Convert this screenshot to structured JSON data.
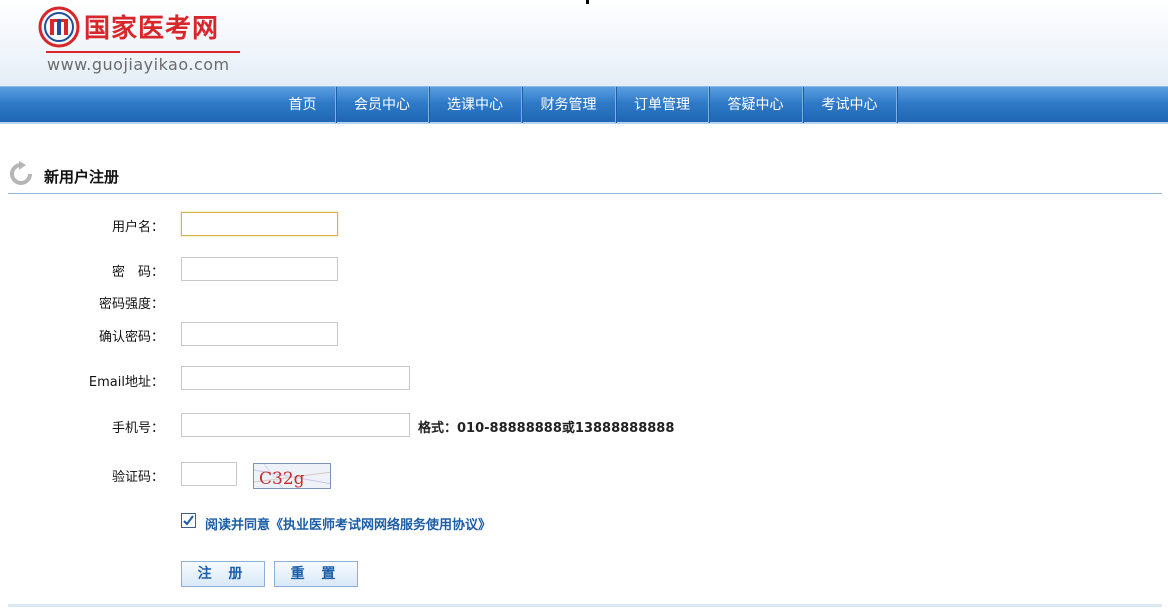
{
  "header": {
    "site_name": "国家医考网",
    "site_url": "www.guojiayikao.com"
  },
  "nav": {
    "items": [
      {
        "label": "首页"
      },
      {
        "label": "会员中心"
      },
      {
        "label": "选课中心"
      },
      {
        "label": "财务管理"
      },
      {
        "label": "订单管理"
      },
      {
        "label": "答疑中心"
      },
      {
        "label": "考试中心"
      }
    ]
  },
  "section": {
    "title": "新用户注册"
  },
  "form": {
    "username_label": "用户名：",
    "username_value": "",
    "password_label": "密　码：",
    "password_value": "",
    "strength_label": "密码强度：",
    "confirm_label": "确认密码：",
    "confirm_value": "",
    "email_label": "Email地址：",
    "email_value": "",
    "phone_label": "手机号：",
    "phone_value": "",
    "phone_hint": "格式：010-88888888或13888888888",
    "captcha_label": "验证码：",
    "captcha_value": "",
    "captcha_image_text": "C32g",
    "agree_checked": true,
    "agree_text": "阅读并同意《执业医师考试网网络服务使用协议》",
    "submit_label": "注 册",
    "reset_label": "重 置"
  },
  "colors": {
    "brand_red": "#d8262a",
    "nav_blue": "#2f7ac8",
    "link_blue": "#1d5ea8"
  }
}
